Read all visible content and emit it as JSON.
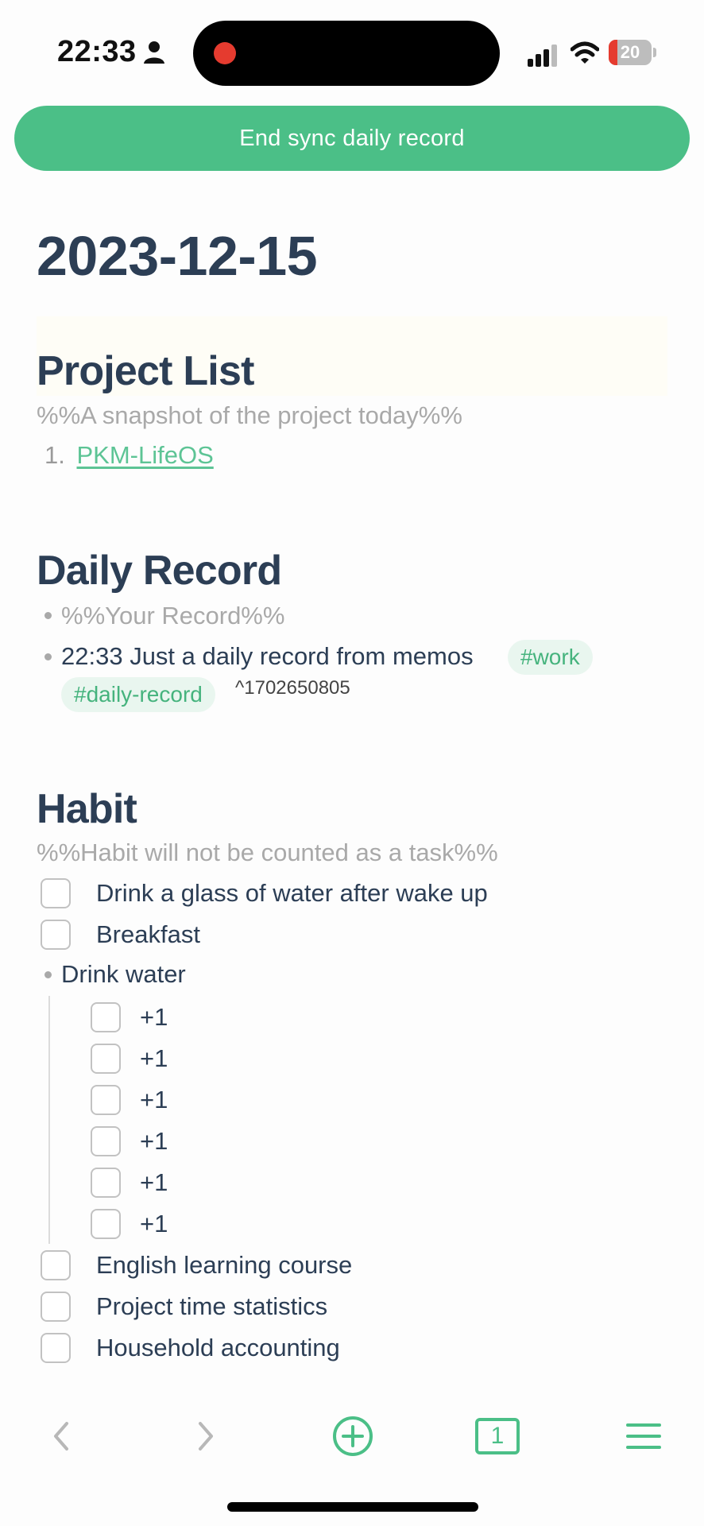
{
  "status_bar": {
    "time": "22:33",
    "battery_level": "20",
    "battery_fraction": 0.2,
    "recording_color": "#e53b2f"
  },
  "sync_button_label": "End sync daily record",
  "accent_color": "#4bbf87",
  "note": {
    "title": "2023-12-15",
    "project_list": {
      "heading": "Project List",
      "comment": "%%A snapshot of the project today%%",
      "items": [
        {
          "number": "1.",
          "label": "PKM-LifeOS"
        }
      ]
    },
    "daily_record": {
      "heading": "Daily Record",
      "comment_bullet": "%%Your Record%%",
      "record": {
        "text": "22:33 Just a daily record from memos",
        "tags": [
          "#work",
          "#daily-record"
        ],
        "block_id": "^1702650805"
      }
    },
    "habit": {
      "heading": "Habit",
      "comment": "%%Habit will not be counted as a task%%",
      "tasks_before": [
        {
          "label": "Drink a glass of water after wake up",
          "checked": false
        },
        {
          "label": "Breakfast",
          "checked": false
        }
      ],
      "drink_water": {
        "label": "Drink water",
        "subtasks": [
          {
            "label": "+1",
            "checked": false
          },
          {
            "label": "+1",
            "checked": false
          },
          {
            "label": "+1",
            "checked": false
          },
          {
            "label": "+1",
            "checked": false
          },
          {
            "label": "+1",
            "checked": false
          },
          {
            "label": "+1",
            "checked": false
          }
        ]
      },
      "tasks_after": [
        {
          "label": "English learning course",
          "checked": false
        },
        {
          "label": "Project time statistics",
          "checked": false
        },
        {
          "label": "Household accounting",
          "checked": false
        }
      ]
    }
  },
  "toolbar": {
    "back_icon": "chevron-left-icon",
    "forward_icon": "chevron-right-icon",
    "new_icon": "plus-circle-icon",
    "tab_count": "1",
    "menu_icon": "hamburger-menu-icon"
  }
}
